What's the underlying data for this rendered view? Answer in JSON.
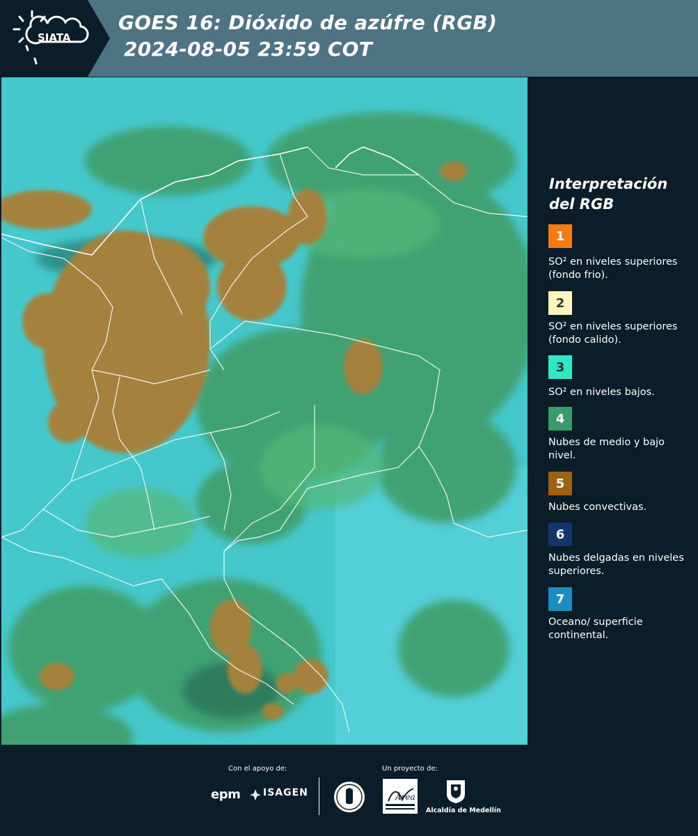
{
  "header": {
    "logo_text": "SIATA",
    "title_line1": "GOES 16: Dióxido de azúfre (RGB)",
    "title_line2": "2024-08-05 23:59 COT"
  },
  "legend": {
    "title_line1": "Interpretación",
    "title_line2": "del RGB",
    "items": [
      {
        "number": "1",
        "color": "#f47c12",
        "text": "SO² en niveles superiores (fondo frio)."
      },
      {
        "number": "2",
        "color": "#fdf5c0",
        "text": "SO² en niveles superiores (fondo calido)."
      },
      {
        "number": "3",
        "color": "#2ee8c8",
        "text": "SO² en niveles bajos."
      },
      {
        "number": "4",
        "color": "#3a9a6a",
        "text": "Nubes de medio y bajo nivel."
      },
      {
        "number": "5",
        "color": "#9a6410",
        "text": "Nubes convectivas."
      },
      {
        "number": "6",
        "color": "#12356a",
        "text": "Nubes delgadas en niveles superiores."
      },
      {
        "number": "7",
        "color": "#1a8ec0",
        "text": "Oceano/ superficie continental."
      }
    ]
  },
  "footer": {
    "support_label": "Con el apoyo de:",
    "project_label": "Un proyecto de:",
    "epm": "epm",
    "isagen": "ISAGEN",
    "area_metropolitana": "Área Metropolitana Valle de Aburrá",
    "alcaldia": "Alcaldía de Medellín"
  },
  "colors": {
    "header_bg": "#4e7382",
    "page_bg": "#0c1d2a",
    "map_low_level": "#45c8cc",
    "map_mid_level": "#3f9e6a",
    "map_convective": "#a4823e"
  }
}
